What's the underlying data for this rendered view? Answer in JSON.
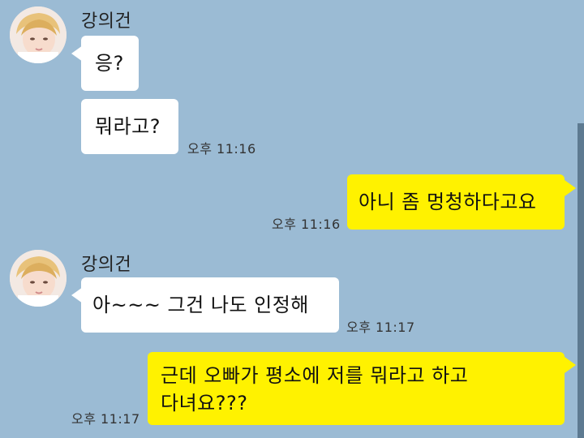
{
  "chat": {
    "messages": [
      {
        "sender": "강의건",
        "text": "응?"
      },
      {
        "text": "뭐라고?",
        "time": "오후 11:16"
      },
      {
        "text": "아니 좀 멍청하다고요",
        "time": "오후 11:16"
      },
      {
        "sender": "강의건",
        "text": "아~~~ 그건 나도 인정해",
        "time": "오후 11:17"
      },
      {
        "text_line1": "근데 오빠가 평소에 저를 뭐라고 하고",
        "text_line2": "다녀요???",
        "time": "오후 11:17"
      }
    ]
  },
  "colors": {
    "background": "#9bbbd4",
    "bubble_in": "#ffffff",
    "bubble_out": "#fff200"
  },
  "icons": {
    "avatar": "profile-photo-icon"
  }
}
